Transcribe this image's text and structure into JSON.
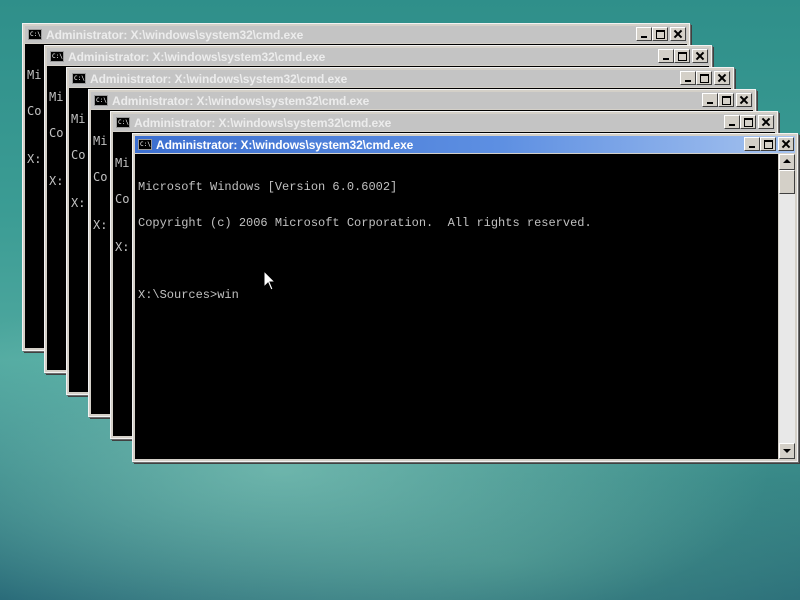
{
  "windows": [
    {
      "title": "Administrator: X:\\windows\\system32\\cmd.exe",
      "ghost_lines": [
        "Mi",
        "Co",
        "X:"
      ]
    },
    {
      "title": "Administrator: X:\\windows\\system32\\cmd.exe",
      "ghost_lines": [
        "Mi",
        "Co",
        "X:"
      ]
    },
    {
      "title": "Administrator: X:\\windows\\system32\\cmd.exe",
      "ghost_lines": [
        "Mi",
        "Co",
        "X:"
      ]
    },
    {
      "title": "Administrator: X:\\windows\\system32\\cmd.exe",
      "ghost_lines": [
        "Mi",
        "Co",
        "X:"
      ]
    },
    {
      "title": "Administrator: X:\\windows\\system32\\cmd.exe",
      "ghost_lines": [
        "Mi",
        "Co",
        "X:"
      ]
    }
  ],
  "active_window": {
    "title": "Administrator: X:\\windows\\system32\\cmd.exe",
    "console_lines": [
      "Microsoft Windows [Version 6.0.6002]",
      "Copyright (c) 2006 Microsoft Corporation.  All rights reserved.",
      "",
      "X:\\Sources>win"
    ]
  },
  "icons": {
    "system_menu": "cmd-icon",
    "minimize": "minimize-icon",
    "maximize": "maximize-icon",
    "close": "close-icon",
    "pointer": "mouse-pointer-icon"
  },
  "colors": {
    "console_bg": "#000000",
    "console_text": "#c0c0c0",
    "active_title": "#3c6fd0",
    "inactive_title": "#c4c4c4"
  }
}
